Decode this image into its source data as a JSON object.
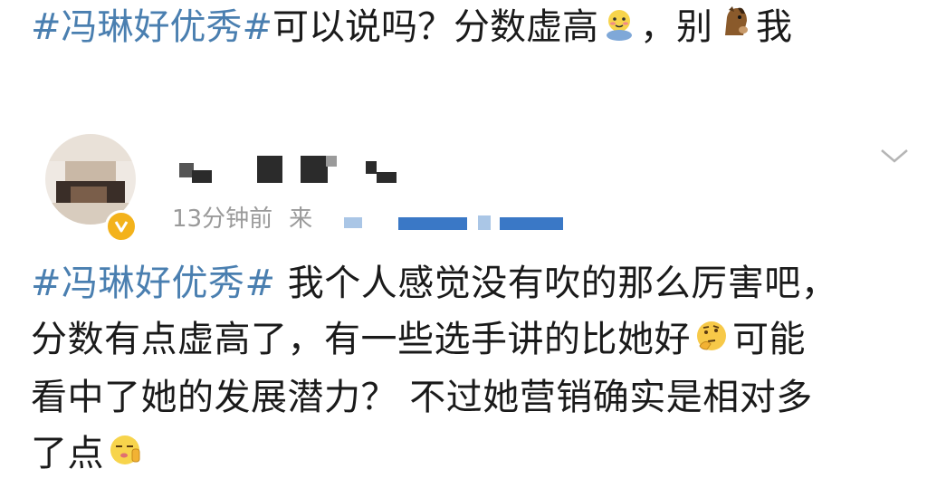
{
  "quote_line": {
    "hashtag": "#冯琳好优秀#",
    "text_a": "可以说吗？分数虚高",
    "emoji_1": "blushing-face-emoji",
    "text_b": "，别",
    "emoji_2": "horse-face-emoji",
    "text_c": "我"
  },
  "post": {
    "username_redacted": true,
    "time_label": "13分钟前",
    "source_prefix": "来",
    "source_redacted": true,
    "menu_icon": "chevron-down-icon",
    "verified_icon": "verified-v-icon",
    "content": {
      "line1_hashtag": "#冯琳好优秀#",
      "line1_text": " 我个人感觉没有吹的那么厉害吧，",
      "line2_text": "分数有点虚高了，有一些选手讲的比她好",
      "line2_emoji": "thinking-face-emoji",
      "line2_tail": "可能",
      "line3_text": "看中了她的发展潜力？ 不过她营销确实是相对多",
      "line4_text": "了点",
      "line4_emoji": "smirk-face-emoji"
    }
  },
  "colors": {
    "hashtag": "#4a7fb0",
    "meta_gray": "#9a9a9a",
    "verified": "#f3b21b"
  }
}
